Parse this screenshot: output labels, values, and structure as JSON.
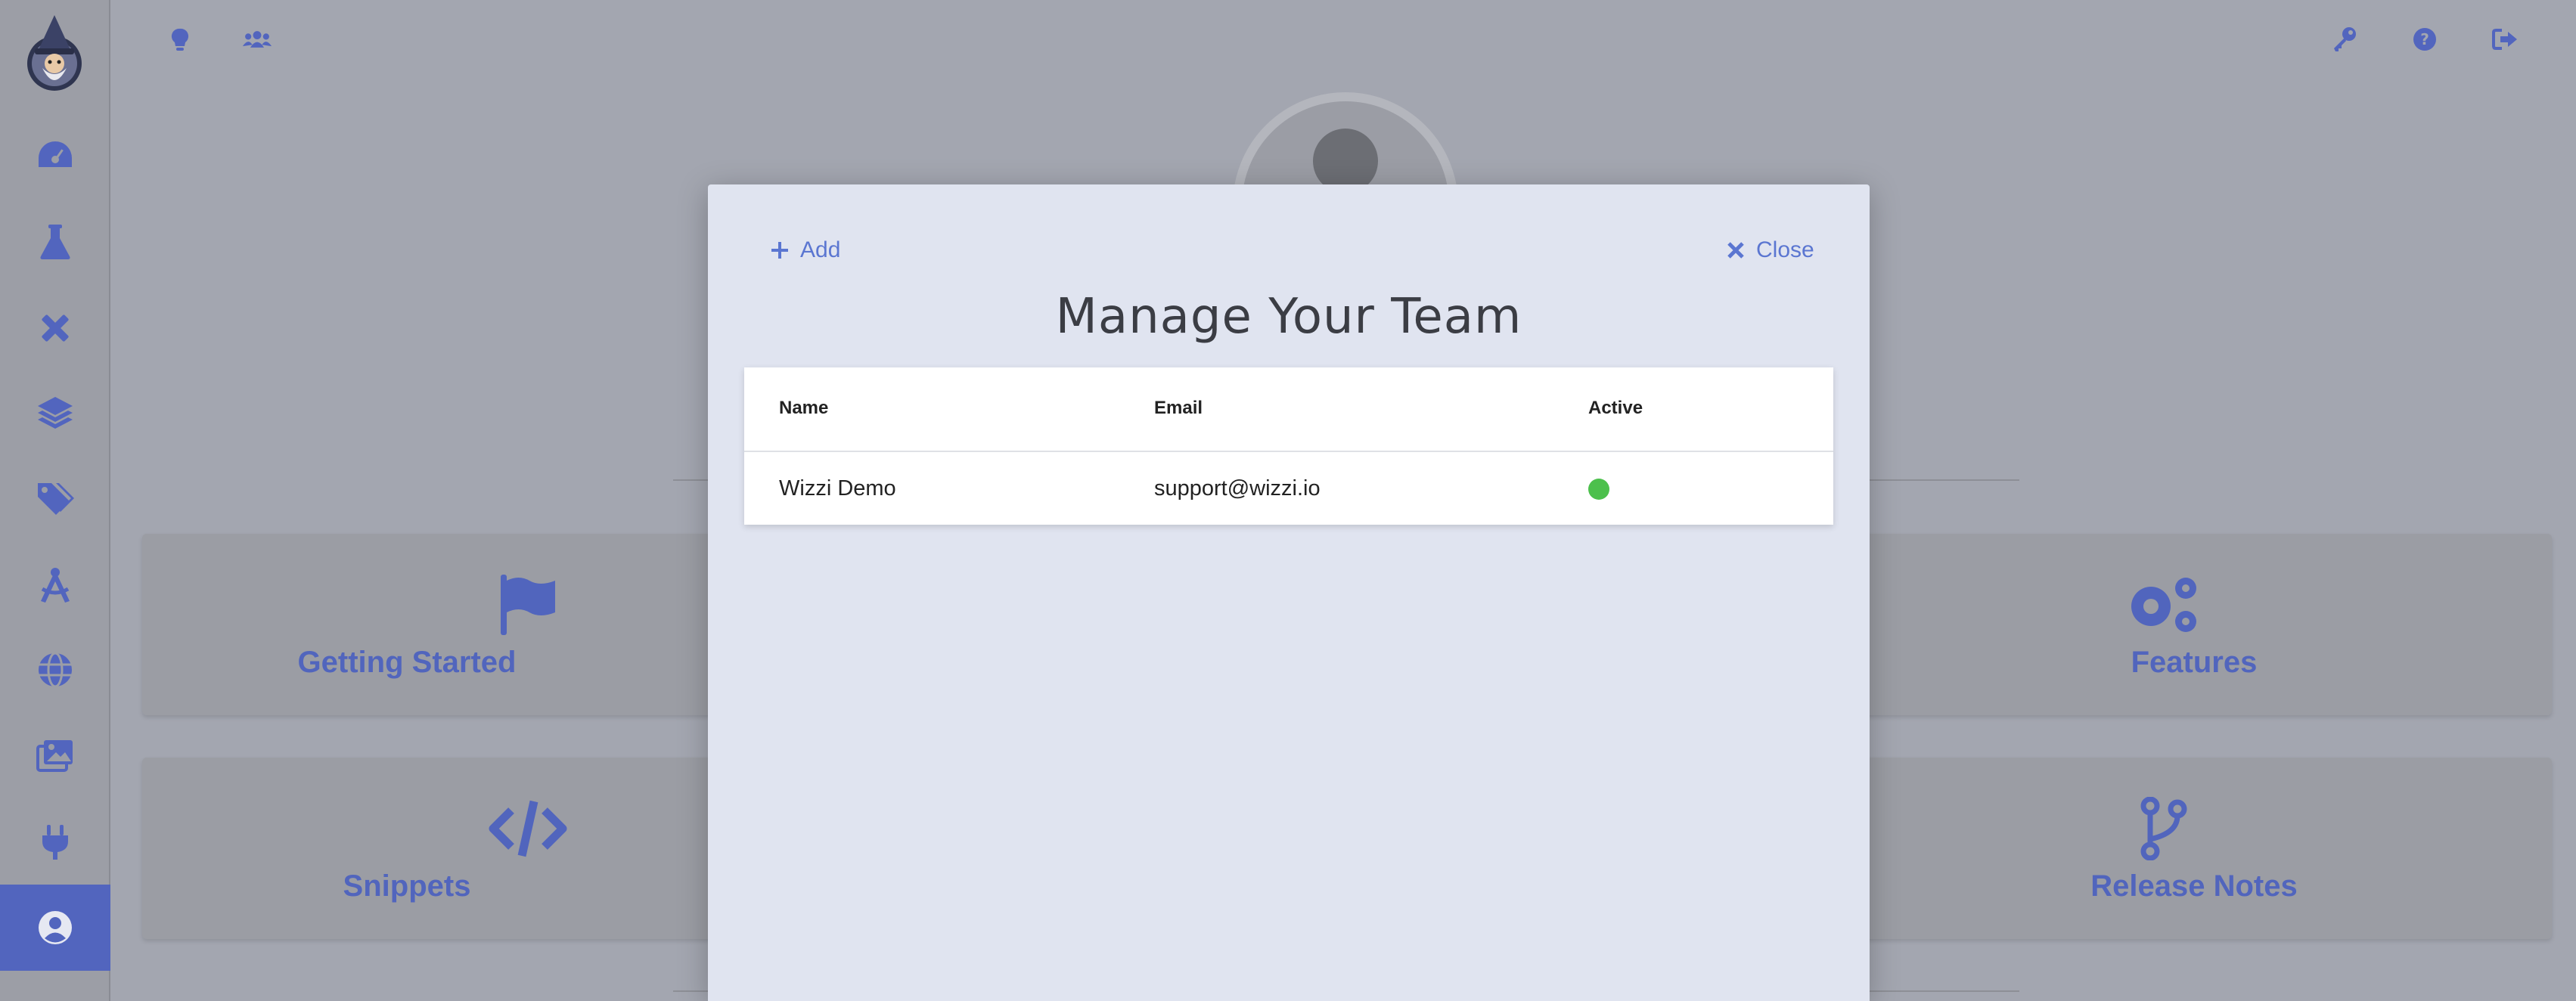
{
  "sidebar": {
    "logo_icon": "wizard-logo-icon",
    "items": [
      {
        "icon": "dashboard-icon"
      },
      {
        "icon": "flask-icon"
      },
      {
        "icon": "design-tools-icon"
      },
      {
        "icon": "layers-icon"
      },
      {
        "icon": "tags-icon"
      },
      {
        "icon": "compass-drafting-icon"
      },
      {
        "icon": "globe-icon"
      },
      {
        "icon": "images-icon"
      },
      {
        "icon": "plug-icon"
      },
      {
        "icon": "user-circle-icon",
        "active": true
      }
    ],
    "active_color": "#5265be"
  },
  "topbar": {
    "left_icons": [
      "lightbulb-icon",
      "users-icon"
    ],
    "right_icons": [
      "key-icon",
      "help-icon",
      "sign-out-icon"
    ]
  },
  "cards": [
    {
      "label": "Getting Started",
      "icon": "flag-icon"
    },
    {
      "label": "Features",
      "icon": "gears-icon"
    },
    {
      "label": "Snippets",
      "icon": "code-icon"
    },
    {
      "label": "Release Notes",
      "icon": "code-branch-icon"
    }
  ],
  "modal": {
    "add_label": "Add",
    "close_label": "Close",
    "title": "Manage Your Team",
    "columns": [
      "Name",
      "Email",
      "Active"
    ],
    "rows": [
      {
        "name": "Wizzi Demo",
        "email": "support@wizzi.io",
        "active": true
      }
    ],
    "accent_color": "#5b76d1",
    "active_color": "#4cc04c"
  }
}
